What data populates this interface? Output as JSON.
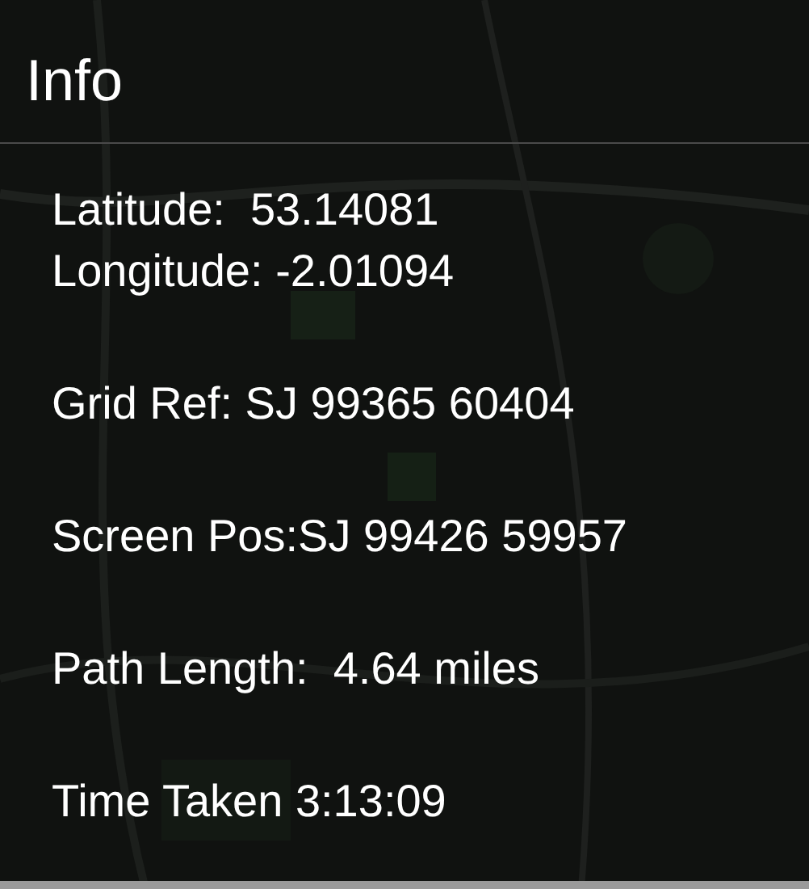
{
  "title": "Info",
  "blocks": [
    {
      "lines": [
        "Latitude:  53.14081",
        "Longitude: -2.01094"
      ]
    },
    {
      "lines": [
        "Grid Ref: SJ 99365 60404"
      ]
    },
    {
      "lines": [
        "Screen Pos:SJ 99426 59957"
      ]
    },
    {
      "lines": [
        "Path Length:  4.64 miles"
      ]
    },
    {
      "lines": [
        "Time Taken 3:13:09"
      ]
    }
  ]
}
